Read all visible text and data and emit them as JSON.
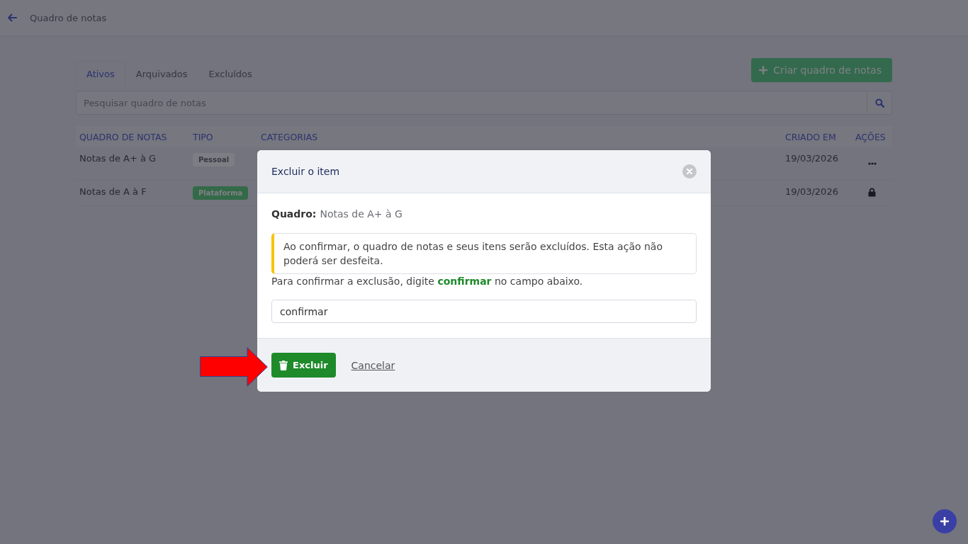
{
  "header": {
    "title": "Quadro de notas"
  },
  "tabs": [
    {
      "label": "Ativos",
      "selected": true
    },
    {
      "label": "Arquivados",
      "selected": false
    },
    {
      "label": "Excluídos",
      "selected": false
    }
  ],
  "create_button": {
    "label": "Criar quadro de notas"
  },
  "search": {
    "placeholder": "Pesquisar quadro de notas"
  },
  "table": {
    "columns": [
      "QUADRO DE NOTAS",
      "TIPO",
      "CATEGORIAS",
      "CRIADO EM",
      "AÇÕES"
    ],
    "rows": [
      {
        "name": "Notas de A+ à G",
        "type": {
          "label": "Pessoal",
          "color": "#7c7e84"
        },
        "created": "19/03/2026",
        "locked": false
      },
      {
        "name": "Notas de A à F",
        "type": {
          "label": "Plataforma",
          "color": "#336a48"
        },
        "created": "19/03/2026",
        "locked": true
      }
    ]
  },
  "dialog": {
    "title": "Excluir o item",
    "board_label": "Quadro:",
    "board_name": "Notas de A+ à G",
    "warning": "Ao confirmar, o quadro de notas e seus itens serão excluídos. Esta ação não poderá ser desfeita.",
    "instruction": "Para confirmar a exclusão, digite **confirmar** no campo abaixo.",
    "input": {
      "value": "confirmar"
    },
    "buttons": [
      {
        "label": "Excluir",
        "kind": "danger"
      },
      {
        "label": "Cancelar",
        "kind": "link"
      }
    ]
  }
}
